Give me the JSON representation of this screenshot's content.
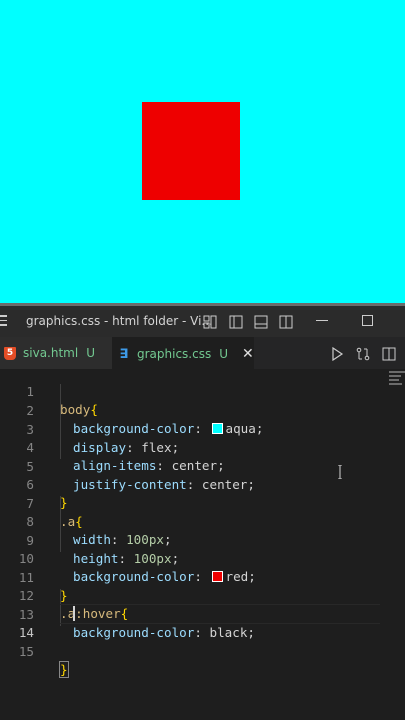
{
  "preview": {
    "background_color": "#00ffff",
    "box_color": "#ee0000"
  },
  "titlebar": {
    "title": "graphics.css - html folder - Vi...",
    "icons": [
      "menu-icon",
      "customize-layout-icon",
      "toggle-sidebar-icon",
      "toggle-panel-icon",
      "toggle-secondary-sidebar-icon",
      "minimize-icon",
      "maximize-icon"
    ]
  },
  "tabs": [
    {
      "name": "siva.html",
      "status": "U",
      "icon": "html-file-icon",
      "active": false
    },
    {
      "name": "graphics.css",
      "status": "U",
      "icon": "css-file-icon",
      "active": true,
      "close": "✕"
    }
  ],
  "tab_actions": [
    "run-icon",
    "compare-changes-icon",
    "split-editor-icon"
  ],
  "editor": {
    "line_numbers": [
      "1",
      "2",
      "3",
      "4",
      "5",
      "6",
      "7",
      "8",
      "9",
      "10",
      "11",
      "12",
      "13",
      "14",
      "15"
    ],
    "active_line": "14",
    "lines": {
      "l1_sel": "body",
      "l1_brace": "{",
      "l2_prop": "background-color",
      "l2_colon": ": ",
      "l2_val": "aqua",
      "l2_semi": ";",
      "l3_prop": "display",
      "l3_rest": ": flex;",
      "l4_prop": "align-items",
      "l4_rest": ": center;",
      "l5_prop": "justify-content",
      "l5_rest": ": center;",
      "l6_brace": "}",
      "l7_sel": ".a",
      "l7_brace": "{",
      "l8_prop": "width",
      "l8_colon": ": ",
      "l8_num": "100px",
      "l8_semi": ";",
      "l9_prop": "height",
      "l9_colon": ": ",
      "l9_num": "100px",
      "l9_semi": ";",
      "l10_prop": "background-color",
      "l10_colon": ": ",
      "l10_val": "red",
      "l10_semi": ";",
      "l11_brace": "}",
      "l12_sel": ".a:hover",
      "l12_brace": "{",
      "l13_prop": "background-color",
      "l13_rest": ": black;",
      "l15_brace": "}"
    },
    "swatch_colors": {
      "aqua": "#00ffff",
      "red": "#ee0000"
    }
  }
}
